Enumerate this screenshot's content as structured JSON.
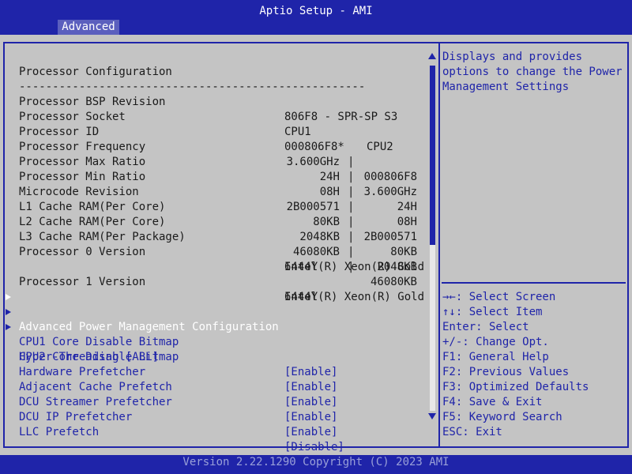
{
  "title": "Aptio Setup - AMI",
  "tab": "Advanced",
  "heading": "Processor Configuration",
  "separator": "----------------------------------------------------",
  "info": {
    "bsp_label": "Processor BSP Revision",
    "bsp_value": "806F8 - SPR-SP S3",
    "socket_label": "Processor Socket",
    "cpu1": "CPU1",
    "cpu2": "CPU2",
    "pairs": [
      {
        "label": "Processor ID",
        "cpu1": "000806F8*",
        "cpu2": "000806F8"
      },
      {
        "label": "Processor Frequency",
        "cpu1": "3.600GHz",
        "cpu2": "3.600GHz"
      },
      {
        "label": "Processor Max Ratio",
        "cpu1": "24H",
        "cpu2": "24H"
      },
      {
        "label": "Processor Min Ratio",
        "cpu1": "08H",
        "cpu2": "08H"
      },
      {
        "label": "Microcode Revision",
        "cpu1": "2B000571",
        "cpu2": "2B000571"
      },
      {
        "label": "L1 Cache RAM(Per Core)",
        "cpu1": "80KB",
        "cpu2": "80KB"
      },
      {
        "label": "L2 Cache RAM(Per Core)",
        "cpu1": "2048KB",
        "cpu2": "2048KB"
      },
      {
        "label": "L3 Cache RAM(Per Package)",
        "cpu1": "46080KB",
        "cpu2": "46080KB"
      }
    ],
    "proc0_label": "Processor 0 Version",
    "proc0_line1": "Intel(R) Xeon(R) Gold",
    "proc0_line2": "6444Y",
    "proc1_label": "Processor 1 Version",
    "proc1_line1": "Intel(R) Xeon(R) Gold",
    "proc1_line2": "6444Y"
  },
  "submenus": [
    "Advanced Power Management Configuration",
    "CPU1 Core Disable Bitmap",
    "CPU2 Core Disable Bitmap"
  ],
  "options": [
    {
      "label": "Hyper-Threading [ALL]",
      "value": "[Enable]"
    },
    {
      "label": "Hardware Prefetcher",
      "value": "[Enable]"
    },
    {
      "label": "Adjacent Cache Prefetch",
      "value": "[Enable]"
    },
    {
      "label": "DCU Streamer Prefetcher",
      "value": "[Enable]"
    },
    {
      "label": "DCU IP Prefetcher",
      "value": "[Enable]"
    },
    {
      "label": "LLC Prefetch",
      "value": "[Disable]"
    }
  ],
  "help_text": [
    "Displays and provides",
    "options to change the Power",
    "Management Settings"
  ],
  "keys": [
    "→←: Select Screen",
    "↑↓: Select Item",
    "Enter: Select",
    "+/-: Change Opt.",
    "F1: General Help",
    "F2: Previous Values",
    "F3: Optimized Defaults",
    "F4: Save & Exit",
    "F5: Keyword Search",
    "ESC: Exit"
  ],
  "footer": "Version 2.22.1290 Copyright (C) 2023 AMI",
  "colors": {
    "blue": "#1f24a9",
    "panel": "#c4c4c4",
    "tab": "#5b5fbe"
  }
}
